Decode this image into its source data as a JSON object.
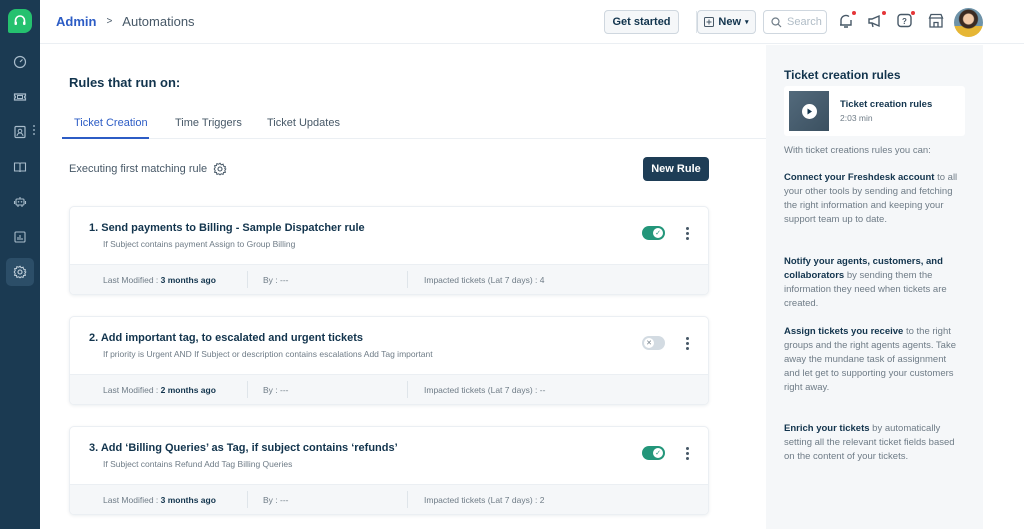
{
  "header": {
    "breadcrumb_root": "Admin",
    "breadcrumb_separator": ">",
    "breadcrumb_current": "Automations",
    "get_started_label": "Get started",
    "new_label": "New",
    "search_placeholder": "Search",
    "icons": [
      "notifications-icon",
      "announcements-icon",
      "help-icon",
      "marketplace-icon"
    ]
  },
  "sidebar": {
    "items": [
      "dashboard",
      "tickets",
      "contacts",
      "solutions",
      "social",
      "analytics",
      "admin"
    ],
    "active": "admin"
  },
  "main": {
    "title": "Rules that run on:",
    "tabs": [
      {
        "label": "Ticket Creation",
        "active": true
      },
      {
        "label": "Time Triggers",
        "active": false
      },
      {
        "label": "Ticket Updates",
        "active": false
      }
    ],
    "execution_mode": "Executing first matching rule",
    "new_rule_label": "New Rule",
    "rules": [
      {
        "name": "1. Send payments to Billing - Sample Dispatcher rule",
        "description": "If Subject contains payment Assign to Group Billing",
        "enabled": true,
        "last_modified_label": "Last Modified : ",
        "last_modified": "3 months ago",
        "by": "By : ---",
        "impacted": "Impacted tickets (Lat 7 days) : 4"
      },
      {
        "name": "2. Add important tag, to escalated and urgent tickets",
        "description": "If priority is Urgent AND If Subject or description contains escalations Add Tag important",
        "enabled": false,
        "last_modified_label": "Last Modified : ",
        "last_modified": "2 months ago",
        "by": "By : ---",
        "impacted": "Impacted tickets (Lat 7 days) : --"
      },
      {
        "name": "3. Add ‘Billing Queries’ as Tag, if subject contains ‘refunds’",
        "description": "If Subject contains Refund Add Tag Billing Queries",
        "enabled": true,
        "last_modified_label": "Last Modified : ",
        "last_modified": "3 months ago",
        "by": "By : ---",
        "impacted": "Impacted tickets (Lat 7 days) : 2"
      }
    ]
  },
  "panel": {
    "title": "Ticket creation rules",
    "video_title": "Ticket creation rules",
    "video_duration": "2:03 min",
    "intro": "With ticket creations rules you can:",
    "paragraphs": [
      {
        "bold": "Connect your Freshdesk account",
        "text": " to all your other tools by sending and fetching the right information and keeping your support team up to date."
      },
      {
        "bold": "Notify your agents, customers, and collaborators",
        "text": " by sending them the information they need when tickets are created."
      },
      {
        "bold": "Assign tickets you receive",
        "text": " to the right groups and the right agents agents. Take away the mundane task of assignment and let get to supporting your customers right away."
      },
      {
        "bold": "Enrich your tickets",
        "text": " by automatically setting all the relevant ticket fields based on the content of your tickets."
      }
    ]
  },
  "colors": {
    "sidebar_bg": "#1b3a52",
    "accent_blue": "#2c5cc5",
    "toggle_on": "#23967a",
    "primary_button": "#1e3d56",
    "logo_green": "#25c16f"
  }
}
